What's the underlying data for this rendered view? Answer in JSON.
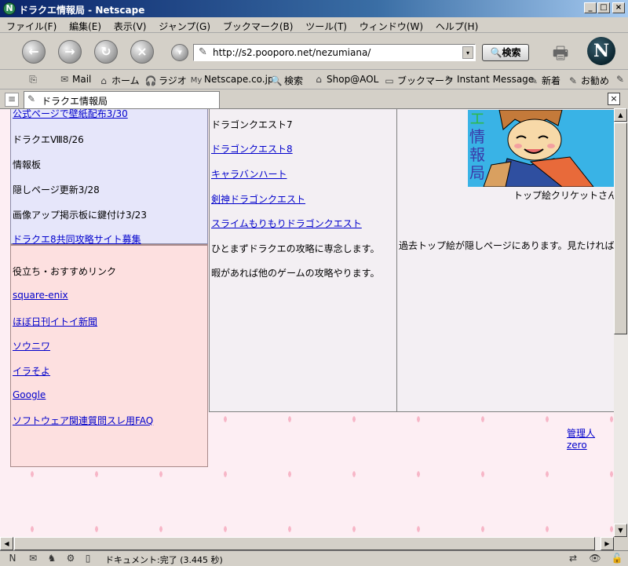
{
  "window": {
    "title": "ドラクエ情報局 - Netscape",
    "app_icon": "N",
    "minimize_label": "_",
    "maximize_label": "□",
    "close_label": "×"
  },
  "menu": {
    "items": [
      {
        "label": "ファイル(F)"
      },
      {
        "label": "編集(E)"
      },
      {
        "label": "表示(V)"
      },
      {
        "label": "ジャンプ(G)"
      },
      {
        "label": "ブックマーク(B)"
      },
      {
        "label": "ツール(T)"
      },
      {
        "label": "ウィンドウ(W)"
      },
      {
        "label": "ヘルプ(H)"
      }
    ]
  },
  "nav": {
    "back_icon": "back-arrow-icon",
    "back_glyph": "←",
    "forward_glyph": "→",
    "reload_glyph": "↻",
    "stop_glyph": "×",
    "down_glyph": "▾",
    "url": "http://s2.pooporo.net/nezumiana/",
    "search_label": "🔍検索",
    "print_glyph": "🖶",
    "logo_letter": "N"
  },
  "personal_toolbar": {
    "items": [
      {
        "label": "",
        "icon": "⎘"
      },
      {
        "label": "Mail",
        "icon": "✉"
      },
      {
        "label": "ホーム",
        "icon": "⌂"
      },
      {
        "label": "ラジオ",
        "icon": "🎧"
      },
      {
        "label": "Netscape.co.jp",
        "icon": "My"
      },
      {
        "label": "検索",
        "icon": "🔍"
      },
      {
        "label": "Shop@AOL",
        "icon": "⌂"
      },
      {
        "label": "ブックマーク",
        "icon": "▭"
      },
      {
        "label": "Instant Message",
        "icon": "✎"
      },
      {
        "label": "新着",
        "icon": "✎"
      },
      {
        "label": "お勧め",
        "icon": "✎"
      },
      {
        "label": "",
        "icon": "✎"
      }
    ]
  },
  "tabs": {
    "sidebar_glyph": "≡",
    "active": {
      "label": "ドラクエ情報局",
      "icon": "✎"
    },
    "close_glyph": "×"
  },
  "content": {
    "left_blue": [
      {
        "text": "公式ページで壁紙配布3/30",
        "link": true
      },
      {
        "text": "ドラクエⅧ8/26",
        "link": false
      },
      {
        "text": "情報板",
        "link": false
      },
      {
        "text": "隠しページ更新3/28",
        "link": false
      },
      {
        "text": "画像アップ掲示板に鍵付け3/23",
        "link": false
      },
      {
        "text": "ドラクエ8共同攻略サイト募集",
        "link": true
      }
    ],
    "left_pink_heading": "役立ち・おすすめリンク",
    "left_pink_links": [
      {
        "text": "square-enix"
      },
      {
        "text": "ほぼ日刊イトイ新聞"
      },
      {
        "text": "ソウニワ"
      },
      {
        "text": "イラそよ"
      },
      {
        "text": "Google"
      },
      {
        "text": "ソフトウェア関連質問スレ用FAQ"
      }
    ],
    "middle": [
      {
        "text": "ドラゴンクエスト7",
        "link": false
      },
      {
        "text": "ドラゴンクエスト8",
        "link": true
      },
      {
        "text": "キャラバンハート",
        "link": true
      },
      {
        "text": "剣神ドラゴンクエスト",
        "link": true
      },
      {
        "text": "スライムもりもりドラゴンクエスト",
        "link": true
      },
      {
        "text": "ひとまずドラクエの攻略に専念します。",
        "link": false
      },
      {
        "text": "暇があれば他のゲームの攻略やります。",
        "link": false
      }
    ],
    "banner_kanji": [
      "エ",
      "情",
      "報",
      "局"
    ],
    "banner_caption": "トップ絵クリケットさん作",
    "past_top_note": "過去トップ絵が隠しページにあります。見たければ探",
    "admin_link": "管理人zero"
  },
  "status": {
    "text": "ドキュメント:完了 (3.445 秒)",
    "icons": [
      "N",
      "✉",
      "♞",
      "⚙",
      "▯"
    ]
  },
  "colors": {
    "title_gradient_start": "#0a246a",
    "link": "#0000cc",
    "left_blue_bg": "#e6e6fa",
    "left_pink_bg": "#fde0e0",
    "page_bg": "#fdeef3",
    "petal": "#f7b6c7",
    "banner_bg": "#39b3e6"
  }
}
